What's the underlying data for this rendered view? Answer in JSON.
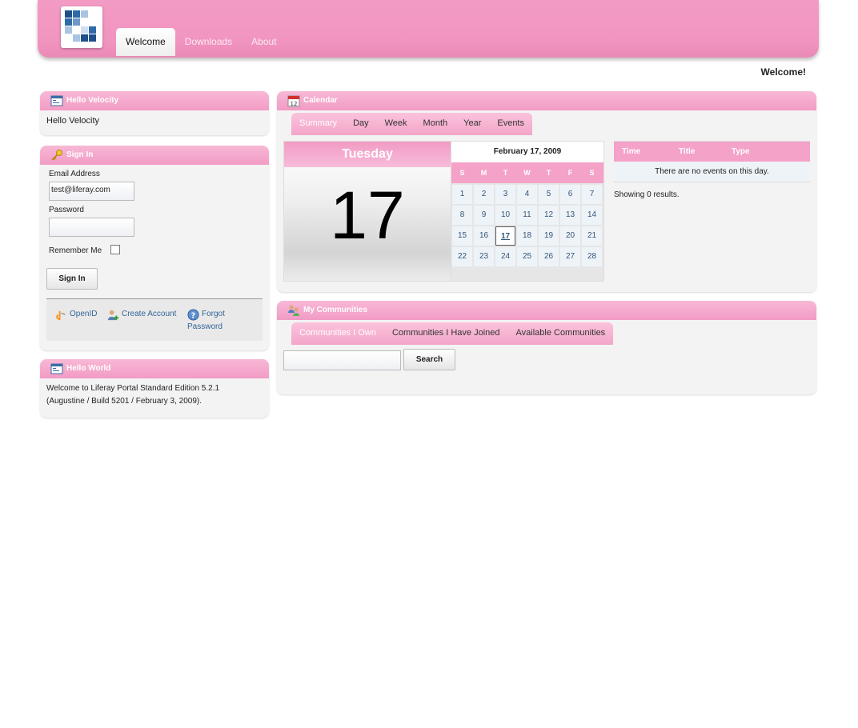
{
  "nav": {
    "items": [
      "Welcome",
      "Downloads",
      "About"
    ]
  },
  "welcome_text": "Welcome!",
  "hello_velocity": {
    "title": "Hello Velocity",
    "body": "Hello Velocity"
  },
  "sign_in": {
    "title": "Sign In",
    "email_label": "Email Address",
    "email_value": "test@liferay.com",
    "password_label": "Password",
    "remember_label": "Remember Me",
    "button": "Sign In",
    "links": {
      "openid": "OpenID",
      "create_account": "Create Account",
      "forgot_1": "Forgot",
      "forgot_2": "Password"
    }
  },
  "hello_world": {
    "title": "Hello World",
    "line1": "Welcome to Liferay Portal Standard Edition 5.2.1",
    "line2": "(Augustine / Build 5201 / February 3, 2009)."
  },
  "calendar": {
    "title": "Calendar",
    "tabs": [
      "Summary",
      "Day",
      "Week",
      "Month",
      "Year",
      "Events"
    ],
    "day_name": "Tuesday",
    "day_number": "17",
    "month_title": "February 17, 2009",
    "dow": [
      "S",
      "M",
      "T",
      "W",
      "T",
      "F",
      "S"
    ],
    "days": [
      "1",
      "2",
      "3",
      "4",
      "5",
      "6",
      "7",
      "8",
      "9",
      "10",
      "11",
      "12",
      "13",
      "14",
      "15",
      "16",
      "17",
      "18",
      "19",
      "20",
      "21",
      "22",
      "23",
      "24",
      "25",
      "26",
      "27",
      "28"
    ],
    "today": "17",
    "events_header": {
      "time": "Time",
      "title": "Title",
      "type": "Type"
    },
    "no_events": "There are no events on this day.",
    "showing": "Showing 0 results."
  },
  "communities": {
    "title": "My Communities",
    "tabs": [
      "Communities I Own",
      "Communities I Have Joined",
      "Available Communities"
    ],
    "search_button": "Search"
  },
  "colors": {
    "accent": "#f29bc4",
    "link": "#336699"
  }
}
